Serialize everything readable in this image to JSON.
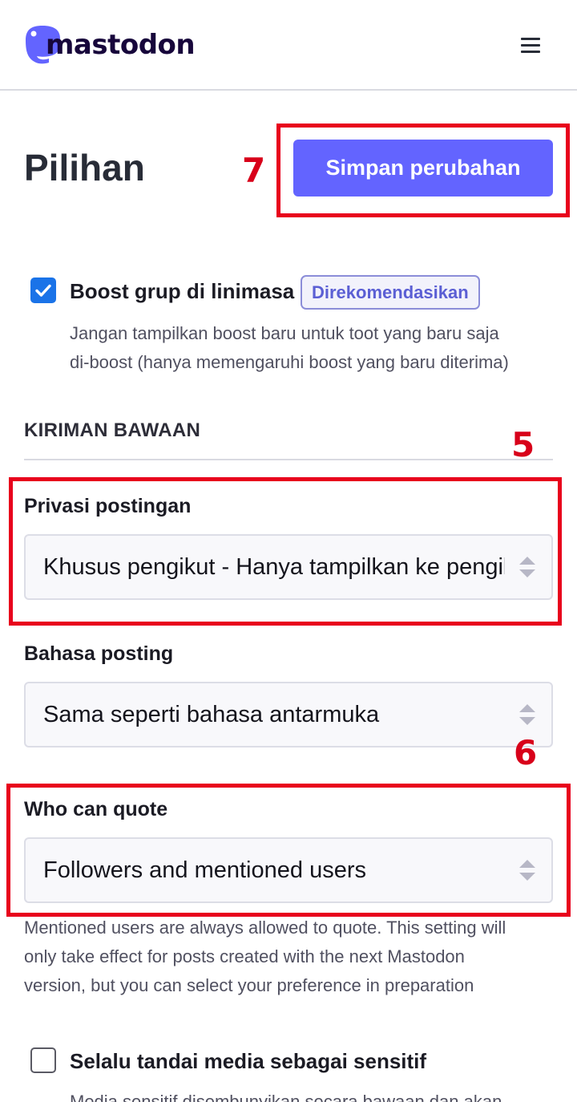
{
  "header": {
    "brand": "mastodon",
    "menu_icon": "hamburger-menu-icon"
  },
  "page": {
    "title": "Pilihan",
    "save_label": "Simpan perubahan"
  },
  "boost_option": {
    "checked": true,
    "label": "Boost grup di linimasa",
    "badge": "Direkomendasikan",
    "hint_line1": "Jangan tampilkan boost baru untuk toot yang baru saja",
    "hint_line2": "di-boost (hanya memengaruhi boost yang baru diterima)"
  },
  "defaults_section": {
    "title": "KIRIMAN BAWAAN"
  },
  "privacy": {
    "label": "Privasi postingan",
    "value": "Khusus pengikut - Hanya tampilkan ke pengikut"
  },
  "language": {
    "label": "Bahasa posting",
    "value": "Sama seperti bahasa antarmuka"
  },
  "quote": {
    "label": "Who can quote",
    "value": "Followers and mentioned users",
    "help_line1": "Mentioned users are always allowed to quote. This setting will",
    "help_line2": "only take effect for posts created with the next Mastodon",
    "help_line3": "version, but you can select your preference in preparation"
  },
  "sensitive_option": {
    "checked": false,
    "label": "Selalu tandai media sebagai sensitif",
    "hint_partial": "Media sensitif disembunyikan secara bawaan dan akan"
  },
  "annotations": {
    "save_marker": "7",
    "privacy_marker": "5",
    "quote_marker": "6",
    "marker_color": "#e8001c"
  },
  "colors": {
    "accent": "#6364ff",
    "checkbox": "#1a73e8"
  }
}
